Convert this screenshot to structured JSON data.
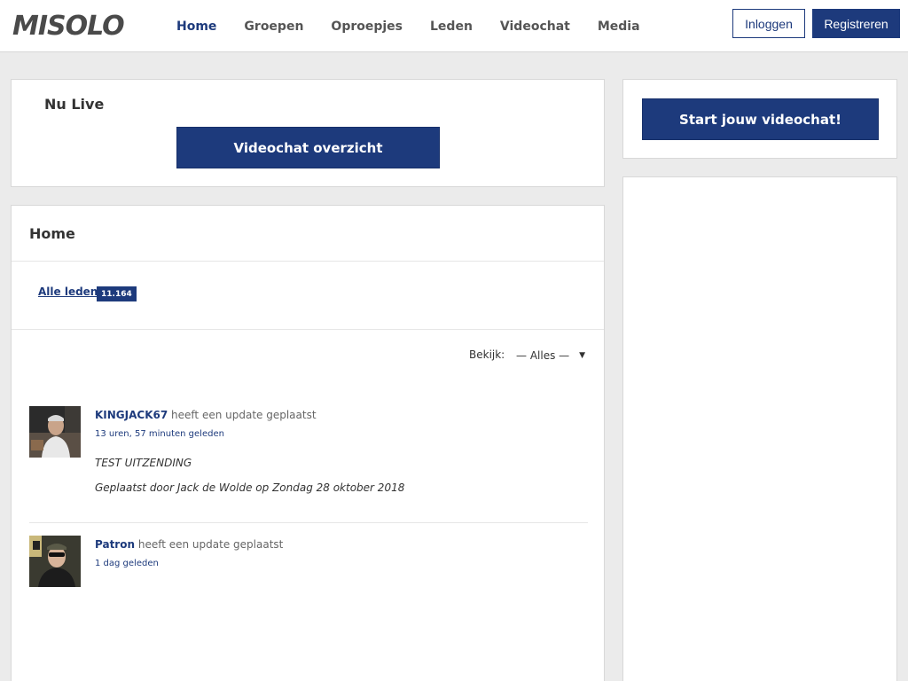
{
  "header": {
    "logo": "MISOLO",
    "nav": [
      {
        "label": "Home",
        "active": true
      },
      {
        "label": "Groepen",
        "active": false
      },
      {
        "label": "Oproepjes",
        "active": false
      },
      {
        "label": "Leden",
        "active": false
      },
      {
        "label": "Videochat",
        "active": false
      },
      {
        "label": "Media",
        "active": false
      }
    ],
    "login_label": "Inloggen",
    "register_label": "Registreren"
  },
  "colors": {
    "accent": "#1d3a7c",
    "background": "#ebebeb"
  },
  "live": {
    "title": "Nu Live",
    "overview_button": "Videochat overzicht"
  },
  "sidebar": {
    "start_button": "Start jouw videochat!"
  },
  "home": {
    "title": "Home",
    "members_link": "Alle leden",
    "members_count": "11.164",
    "filter_label": "Bekijk:",
    "filter_value": "— Alles —"
  },
  "activities": [
    {
      "user": "KINGJACK67",
      "action": "heeft een update geplaatst",
      "time": "13 uren, 57 minuten geleden",
      "body": [
        "TEST UITZENDING",
        "Geplaatst door Jack de Wolde op Zondag 28 oktober 2018"
      ]
    },
    {
      "user": "Patron",
      "action": "heeft een update geplaatst",
      "time": "1 dag geleden",
      "body": []
    }
  ]
}
